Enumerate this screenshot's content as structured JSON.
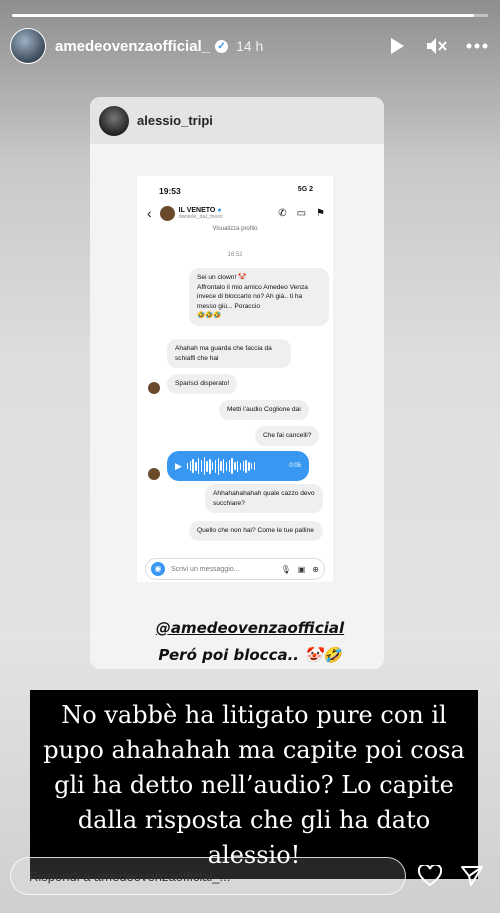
{
  "story": {
    "progress": 0.97,
    "username": "amedeovenzaofficial_",
    "time": "14 h"
  },
  "card": {
    "username": "alessio_tripi",
    "phone_status": {
      "time": "19:53",
      "signal": "5G",
      "battery": "2"
    },
    "chat": {
      "name": "IL VENETO",
      "handle": "daniele_dal_moro",
      "top_text": "Visualizza profilo",
      "timestamp": "16:52",
      "messages": [
        {
          "text": "Sei un clown! 🤡\nAffrontalo il mio amico Amedeo Venza invece di bloccarlo no? Ah già.. ti ha messo giù... Poraccio\n🤣🤣🤣"
        },
        {
          "text": "Ahahah ma guarda che faccia da schiaffi che hai"
        },
        {
          "text": "Sparisci disperato!"
        },
        {
          "text": "Metti l’audio Coglione dai"
        },
        {
          "text": "Che fai cancelli?"
        },
        {
          "text": "Ahhahahahahah quale cazzo devo succhiare?"
        },
        {
          "text": "Quello che non hai? Come le tue palline"
        }
      ],
      "audio_duration": "0:05",
      "composer_placeholder": "Scrivi un messaggio..."
    },
    "mention": "@amedeovenzaofficial",
    "subline": "Peró poi blocca.. 🤡🤣"
  },
  "caption": "No vabbè ha litigato pure con il pupo ahahahah ma capite poi cosa gli ha detto nell’audio? Lo capite dalla risposta che gli ha dato alessio!",
  "footer": {
    "reply_placeholder": "Rispondi a amedeovenzaofficial_..."
  }
}
